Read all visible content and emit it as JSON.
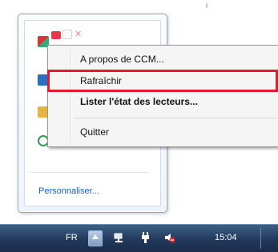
{
  "context_menu": {
    "items": [
      {
        "label": "A propos de CCM...",
        "bold": false
      },
      {
        "label": "Rafraîchir",
        "bold": false
      },
      {
        "label": "Lister l'état des lecteurs...",
        "bold": true
      },
      {
        "label": "Quitter",
        "bold": false
      }
    ],
    "highlighted_item": "Rafraîchir",
    "highlight_color": "#e11b2b"
  },
  "tray_flyout": {
    "customize_link": "Personnaliser...",
    "icons": [
      "ccm-icon",
      "red-app-icon",
      "blank-icon",
      "red-x-icon",
      "blue-app-icon",
      "yellow-app-icon",
      "green-app-icon"
    ]
  },
  "taskbar": {
    "language": "FR",
    "clock": "15:04",
    "icons": [
      "show-hidden-icons-arrow",
      "network-icon",
      "power-icon",
      "speaker-muted-icon"
    ]
  }
}
